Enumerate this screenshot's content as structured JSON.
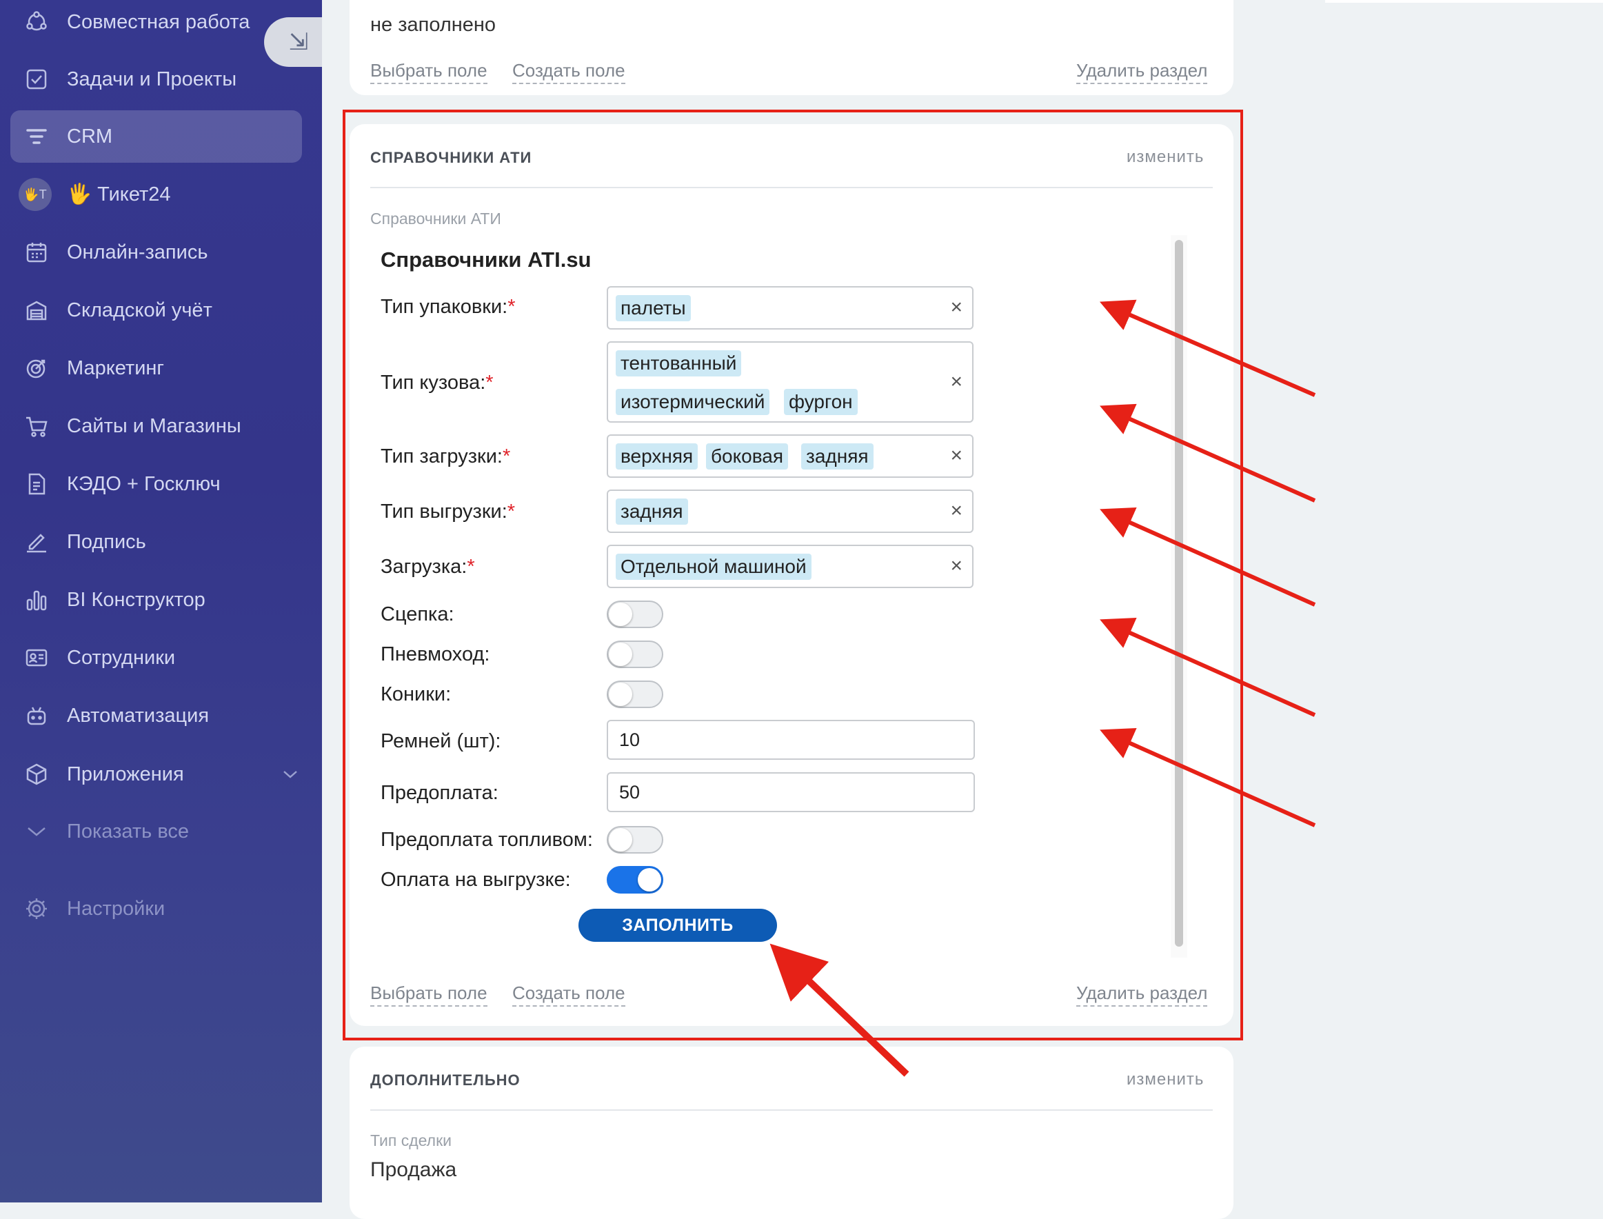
{
  "sidebar": {
    "collapse_icon": "collapse-arrow-icon",
    "items": [
      {
        "label": "Совместная работа",
        "icon": "collaboration-icon"
      },
      {
        "label": "Задачи и Проекты",
        "icon": "task-checkbox-icon"
      },
      {
        "label": "CRM",
        "icon": "crm-filter-icon",
        "active": true
      },
      {
        "label": "🖐 Тикет24",
        "icon": "hand-badge-icon",
        "badge": "🖐T"
      },
      {
        "label": "Онлайн-запись",
        "icon": "calendar-icon"
      },
      {
        "label": "Складской учёт",
        "icon": "warehouse-icon"
      },
      {
        "label": "Маркетинг",
        "icon": "target-icon"
      },
      {
        "label": "Сайты и Магазины",
        "icon": "cart-icon"
      },
      {
        "label": "КЭДО + Госключ",
        "icon": "document-icon"
      },
      {
        "label": "Подпись",
        "icon": "signature-icon"
      },
      {
        "label": "BI Конструктор",
        "icon": "bar-chart-icon"
      },
      {
        "label": "Сотрудники",
        "icon": "employees-icon"
      },
      {
        "label": "Автоматизация",
        "icon": "robot-icon"
      },
      {
        "label": "Приложения",
        "icon": "cube-icon",
        "has_chevron": true
      },
      {
        "label": "Показать все",
        "icon": "chevron-down-icon"
      },
      {
        "label": "Настройки",
        "icon": "gear-icon"
      }
    ]
  },
  "top_card": {
    "value": "не заполнено",
    "select_field": "Выбрать поле",
    "create_field": "Создать поле",
    "delete_section": "Удалить раздел"
  },
  "ati_card": {
    "title": "СПРАВОЧНИКИ АТИ",
    "action": "изменить",
    "field_label": "Справочники АТИ",
    "select_field": "Выбрать поле",
    "create_field": "Создать поле",
    "delete_section": "Удалить раздел"
  },
  "ati_form": {
    "title": "Справочники ATI.su",
    "packaging": {
      "label": "Тип упаковки:",
      "values": [
        "палеты"
      ]
    },
    "body": {
      "label": "Тип кузова:",
      "values": [
        "тентованный",
        "изотермический",
        "фургон"
      ]
    },
    "loading_type": {
      "label": "Тип загрузки:",
      "values": [
        "верхняя",
        "боковая",
        "задняя"
      ]
    },
    "unloading_type": {
      "label": "Тип выгрузки:",
      "values": [
        "задняя"
      ]
    },
    "loading": {
      "label": "Загрузка:",
      "values": [
        "Отдельной машиной"
      ]
    },
    "required_mark": "*",
    "clear": "×",
    "coupling": {
      "label": "Сцепка:",
      "on": false
    },
    "pneumatic": {
      "label": "Пневмоход:",
      "on": false
    },
    "koniki": {
      "label": "Коники:",
      "on": false
    },
    "belts": {
      "label": "Ремней (шт):",
      "value": "10"
    },
    "prepayment": {
      "label": "Предоплата:",
      "value": "50"
    },
    "fuel_prepayment": {
      "label": "Предоплата топливом:",
      "on": false
    },
    "pay_on_unload": {
      "label": "Оплата на выгрузке:",
      "on": true
    },
    "fill_button": "ЗАПОЛНИТЬ"
  },
  "extra_card": {
    "title": "ДОПОЛНИТЕЛЬНО",
    "action": "изменить",
    "field_label": "Тип сделки",
    "value": "Продажа"
  },
  "annotation_color": "#e62117"
}
